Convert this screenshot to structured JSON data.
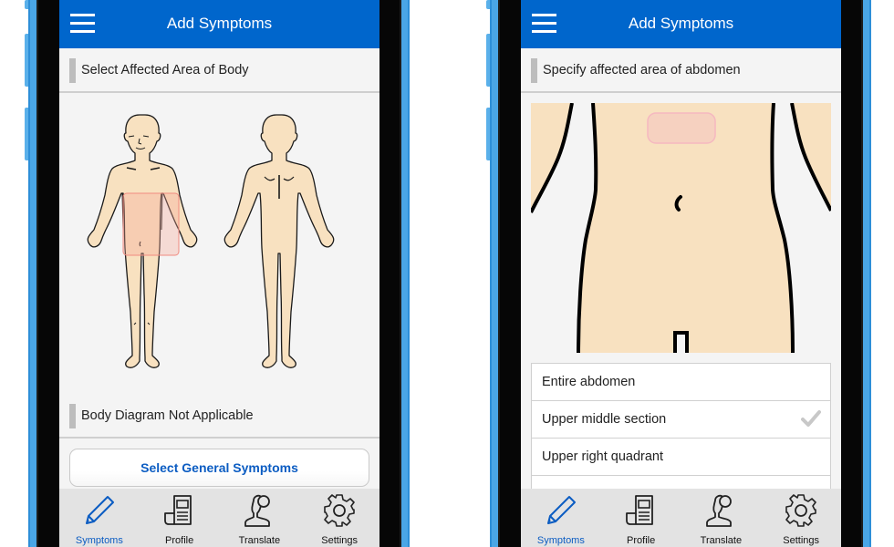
{
  "colors": {
    "header_blue": "#0066cc",
    "phone_frame": "#4aa6e6",
    "accent_text": "#0b5cc2",
    "skin": "#f8e1c0",
    "highlight": "#f5c6c0"
  },
  "screens": [
    {
      "header": {
        "menu_icon": "hamburger-menu-icon",
        "title": "Add Symptoms"
      },
      "section_title": "Select Affected Area of Body",
      "diagram": {
        "views": [
          "front",
          "back"
        ],
        "highlighted_region": "abdomen"
      },
      "secondary_section_title": "Body Diagram Not Applicable",
      "general_button": "Select General Symptoms",
      "tabs": [
        {
          "label": "Symptoms",
          "icon": "pencil-icon",
          "active": true
        },
        {
          "label": "Profile",
          "icon": "document-icon",
          "active": false
        },
        {
          "label": "Translate",
          "icon": "person-speech-icon",
          "active": false
        },
        {
          "label": "Settings",
          "icon": "gear-icon",
          "active": false
        }
      ]
    },
    {
      "header": {
        "menu_icon": "hamburger-menu-icon",
        "title": "Add Symptoms"
      },
      "section_title": "Specify affected area of abdomen",
      "diagram": {
        "view": "abdomen-closeup",
        "highlighted_region": "upper middle"
      },
      "options": [
        {
          "label": "Entire abdomen",
          "selected": false
        },
        {
          "label": "Upper middle section",
          "selected": true
        },
        {
          "label": "Upper right quadrant",
          "selected": false
        },
        {
          "label": "",
          "selected": false
        }
      ],
      "tabs": [
        {
          "label": "Symptoms",
          "icon": "pencil-icon",
          "active": true
        },
        {
          "label": "Profile",
          "icon": "document-icon",
          "active": false
        },
        {
          "label": "Translate",
          "icon": "person-speech-icon",
          "active": false
        },
        {
          "label": "Settings",
          "icon": "gear-icon",
          "active": false
        }
      ]
    }
  ]
}
